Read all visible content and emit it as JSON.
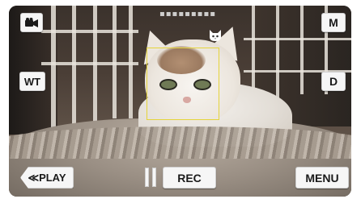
{
  "topbar": {
    "camera_mode_icon": "movie-camera-icon",
    "manual_label": "M",
    "status_text": "▪▪▪▪▪▪▪▪▪"
  },
  "left_controls": {
    "zoom_label": "WT"
  },
  "right_controls": {
    "display_label": "D"
  },
  "detection": {
    "icon": "pet-face-icon",
    "box_color": "#e5d43a"
  },
  "bottombar": {
    "play_label": "≪PLAY",
    "rec_label": "REC",
    "menu_label": "MENU",
    "pause_icon": "pause-icon"
  }
}
